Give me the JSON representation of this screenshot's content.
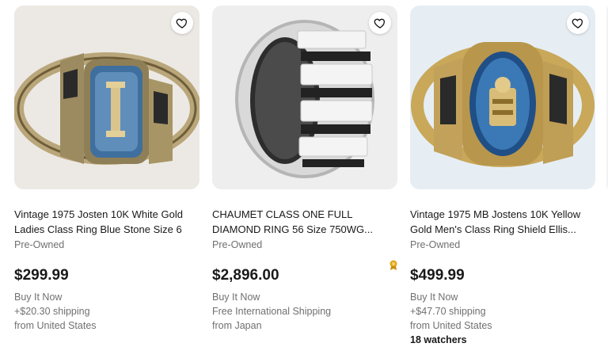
{
  "listings": [
    {
      "title": "Vintage 1975 Josten 10K White Gold Ladies Class Ring Blue Stone Size 6",
      "condition": "Pre-Owned",
      "price": "$299.99",
      "format": "Buy It Now",
      "shipping": "+$20.30 shipping",
      "location": "from United States",
      "image_icon": "class-ring-blue-stone"
    },
    {
      "title": "CHAUMET CLASS ONE FULL DIAMOND RING 56 Size 750WG...",
      "condition": "Pre-Owned",
      "price": "$2,896.00",
      "format": "Buy It Now",
      "shipping": "Free International Shipping",
      "location": "from Japan",
      "image_icon": "diamond-band-ring"
    },
    {
      "title": "Vintage 1975 MB Jostens 10K Yellow Gold Men's Class Ring Shield Ellis...",
      "condition": "Pre-Owned",
      "price": "$499.99",
      "format": "Buy It Now",
      "shipping": "+$47.70 shipping",
      "location": "from United States",
      "watchers": "18 watchers",
      "image_icon": "class-ring-shield-gold"
    }
  ],
  "colors": {
    "text_primary": "#191919",
    "text_secondary": "#707070",
    "card_bg": "#f3f3f3",
    "badge": "#e0a51a"
  }
}
